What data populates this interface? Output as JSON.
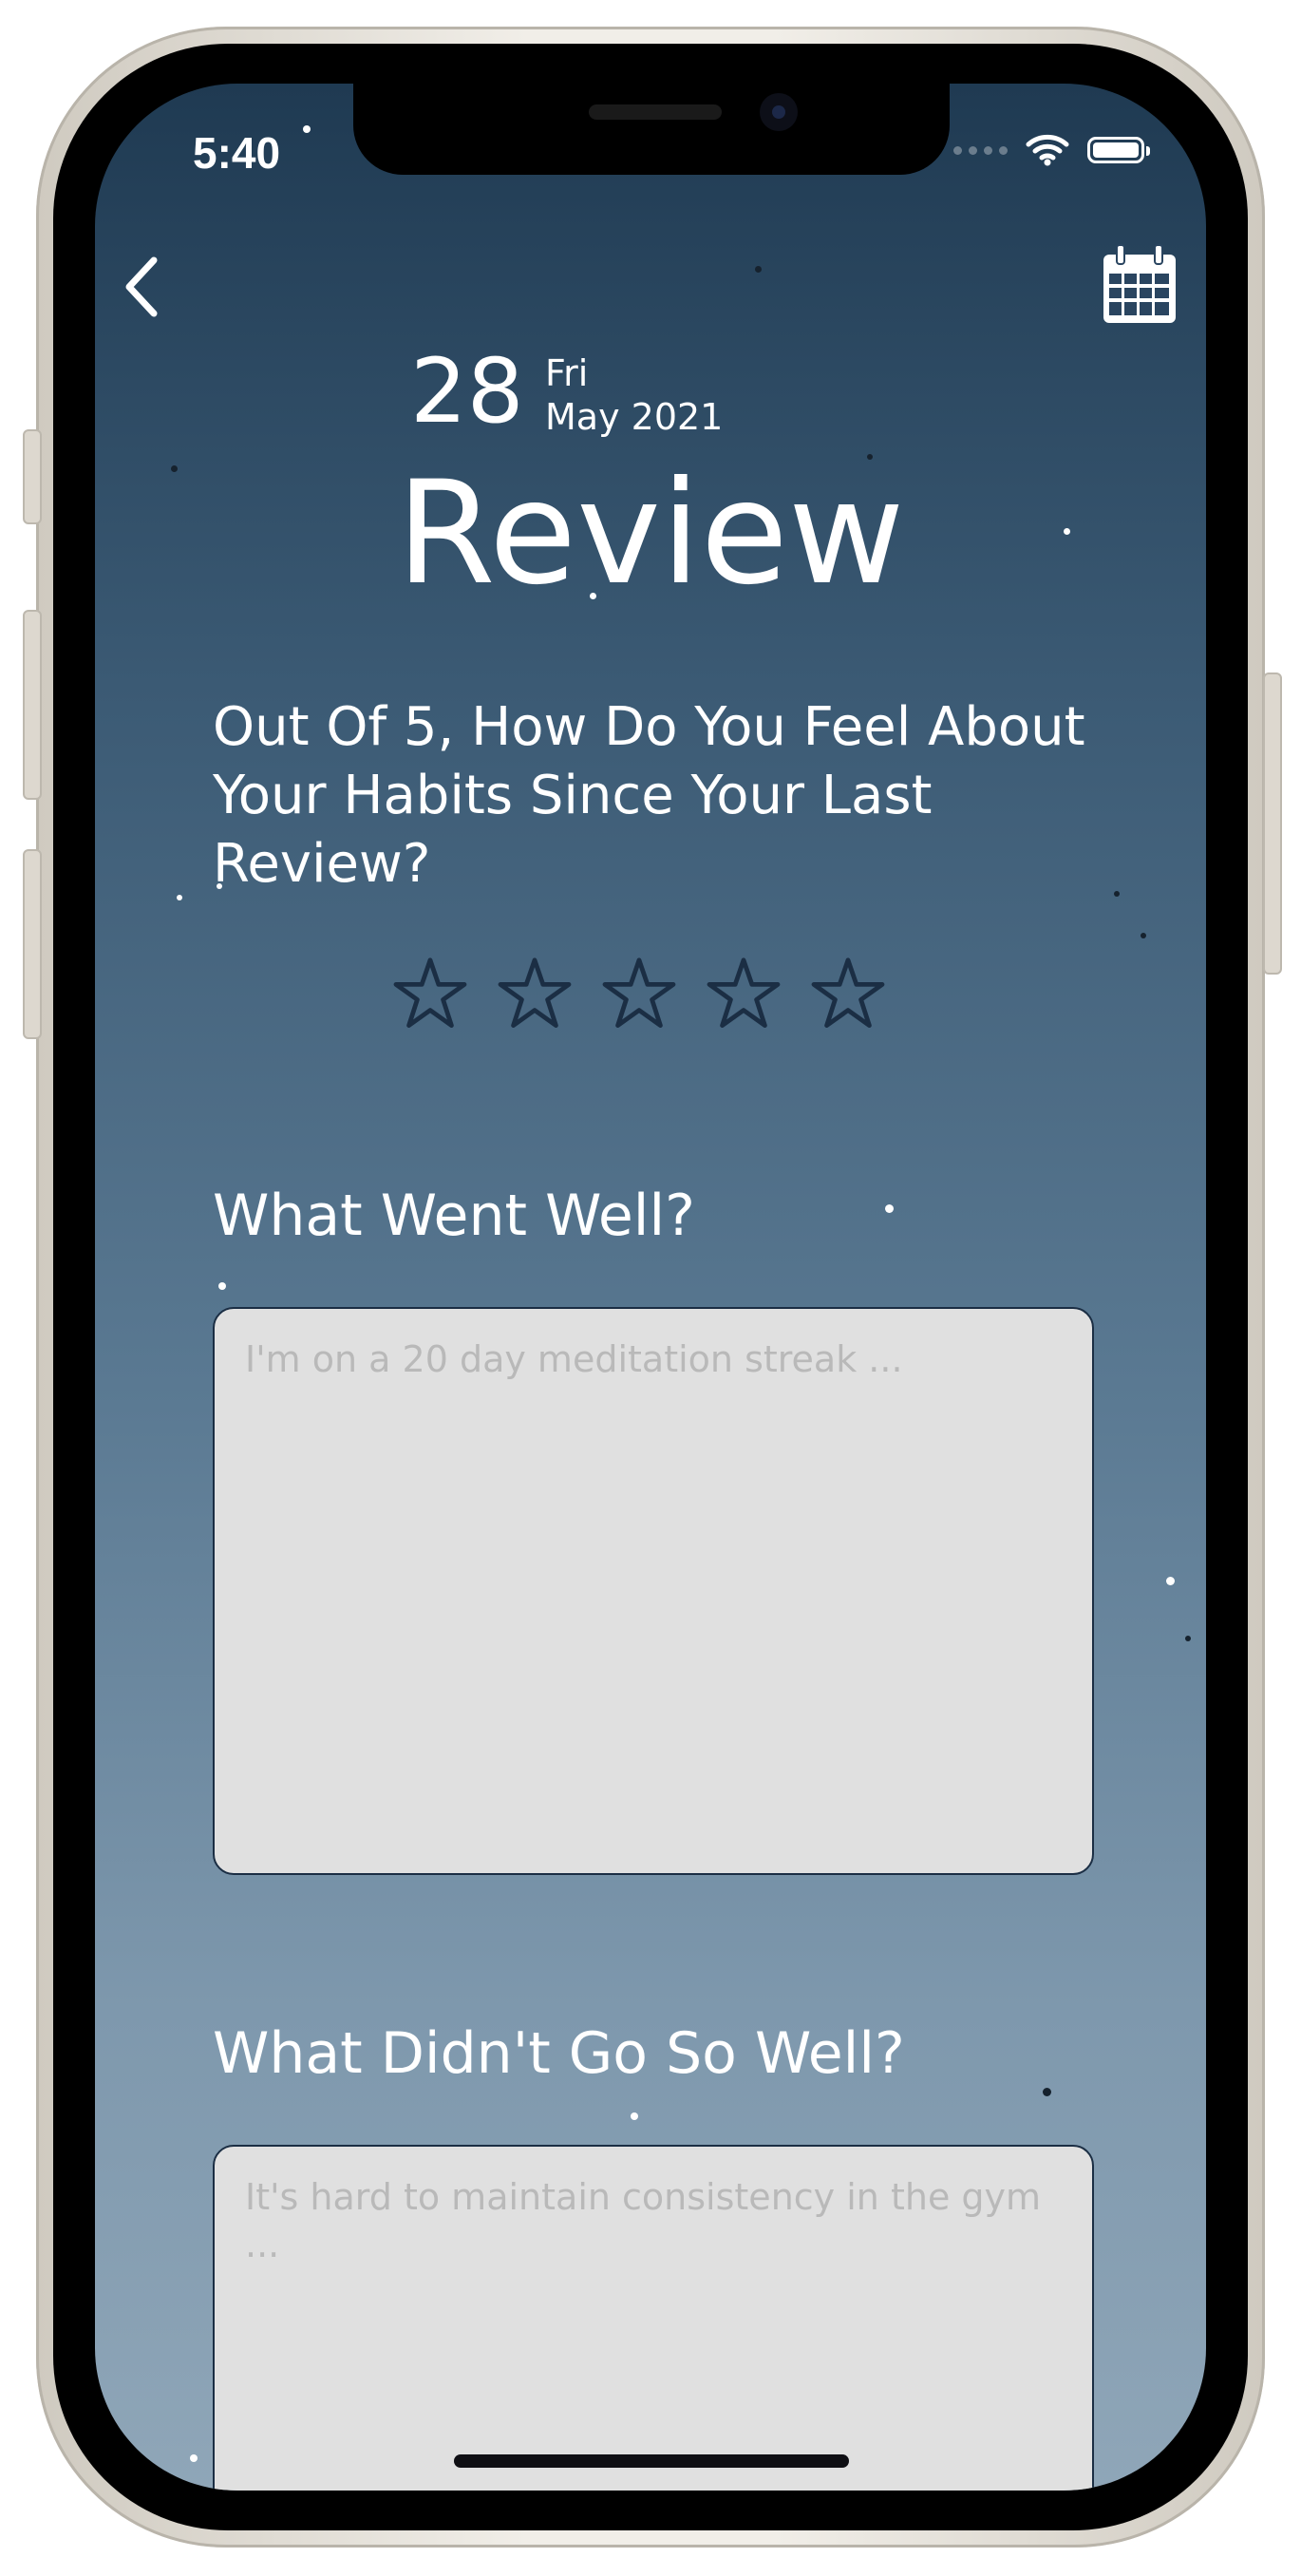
{
  "status_bar": {
    "time": "5:40"
  },
  "nav": {
    "back_icon": "chevron-left-icon",
    "calendar_icon": "calendar-icon"
  },
  "date": {
    "day": "28",
    "weekday": "Fri",
    "month_year": "May 2021"
  },
  "title": "Review",
  "rating": {
    "question": "Out Of 5, How Do You Feel About Your Habits Since Your Last Review?",
    "stars": 5,
    "selected": 0,
    "star_color": "#1b2e44"
  },
  "went_well": {
    "label": "What Went Well?",
    "placeholder": "I'm on a 20 day meditation streak ..."
  },
  "not_well": {
    "label": "What Didn't Go So Well?",
    "placeholder": "It's hard to maintain consistency in the gym ..."
  },
  "colors": {
    "gradient_top": "#1f3a52",
    "gradient_bottom": "#8fa6b8",
    "field_bg": "#e0e0e0",
    "field_border": "#1b2e44"
  }
}
